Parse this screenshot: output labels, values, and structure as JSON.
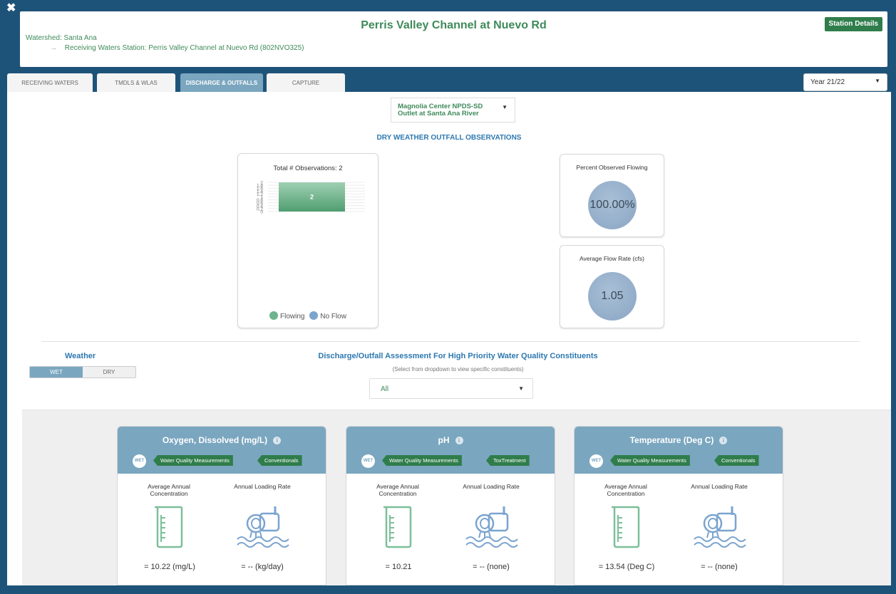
{
  "header": {
    "close_glyph": "✖",
    "station_title": "Perris Valley Channel at Nuevo Rd",
    "watershed_label": "Watershed:",
    "watershed_value": "Santa Ana",
    "receiving_label": "Receiving Waters Station:",
    "receiving_value": "Perris Valley Channel at Nuevo Rd (802NVO325)",
    "station_details_button": "Station Details"
  },
  "tabs": [
    {
      "label": "RECEIVING WATERS",
      "active": false
    },
    {
      "label": "TMDLS & WLAS",
      "active": false
    },
    {
      "label": "DISCHARGE & OUTFALLS",
      "active": true
    },
    {
      "label": "CAPTURE",
      "active": false
    }
  ],
  "year_select": {
    "value": "Year 21/22"
  },
  "outfall_select": {
    "line1": "Magnolia Center NPDS-SD",
    "line2": "Outlet at Santa Ana River"
  },
  "section_title": "DRY WEATHER OUTFALL OBSERVATIONS",
  "observations_chart": {
    "title": "Total # Observations:  2",
    "legend": [
      {
        "name": "Flowing",
        "color": "#6db38c"
      },
      {
        "name": "No Flow",
        "color": "#7ba4cf"
      }
    ]
  },
  "chart_data": {
    "type": "bar",
    "title": "Total # Observations:  2",
    "categories": [
      "Flowing"
    ],
    "series": [
      {
        "name": "Flowing",
        "values": [
          2
        ]
      },
      {
        "name": "No Flow",
        "values": [
          0
        ]
      }
    ],
    "stacked": true,
    "ylim": [
      0,
      2
    ],
    "yticks": [
      "0",
      "0.2",
      "0.4",
      "0.6",
      "0.8",
      "1",
      "1.2",
      "1.4",
      "1.6",
      "1.8",
      "2"
    ],
    "data_labels": [
      "2"
    ],
    "grid": true,
    "legend_position": "bottom"
  },
  "metrics": {
    "percent_flowing": {
      "label": "Percent Observed Flowing",
      "value": "100.00%"
    },
    "avg_flow": {
      "label": "Average Flow Rate (cfs)",
      "value": "1.05"
    }
  },
  "weather": {
    "label": "Weather",
    "wet": "WET",
    "dry": "DRY",
    "selected": "WET"
  },
  "assessment": {
    "title": "Discharge/Outfall Assessment For High Priority Water Quality Constituents",
    "subtitle": "(Select from dropdown to view specific constituents)",
    "select_value": "All"
  },
  "constituents": [
    {
      "title": "Oxygen, Dissolved (mg/L)",
      "badge": "WET",
      "tag1": "Water Quality Measurements",
      "tag2": "Conventionals",
      "col1": "Average Annual Concentration",
      "col2": "Annual Loading Rate",
      "val1": "= 10.22 (mg/L)",
      "val2": "= -- (kg/day)"
    },
    {
      "title": "pH",
      "badge": "WET",
      "tag1": "Water Quality Measurements",
      "tag2": "ToxTreatment",
      "col1": "Average Annual Concentration",
      "col2": "Annual Loading Rate",
      "val1": "= 10.21",
      "val2": "= -- (none)"
    },
    {
      "title": "Temperature (Deg C)",
      "badge": "WET",
      "tag1": "Water Quality Measurements",
      "tag2": "Conventionals",
      "col1": "Average Annual Concentration",
      "col2": "Annual Loading Rate",
      "val1": "= 13.54 (Deg C)",
      "val2": "= -- (none)"
    }
  ],
  "colors": {
    "accent_blue": "#7aa6bf",
    "green": "#2f7d4b",
    "title_blue": "#2d78b0",
    "bar_green": "#6db38c"
  },
  "icons": {
    "info": "i",
    "caret": "▼",
    "arrow": "→"
  }
}
